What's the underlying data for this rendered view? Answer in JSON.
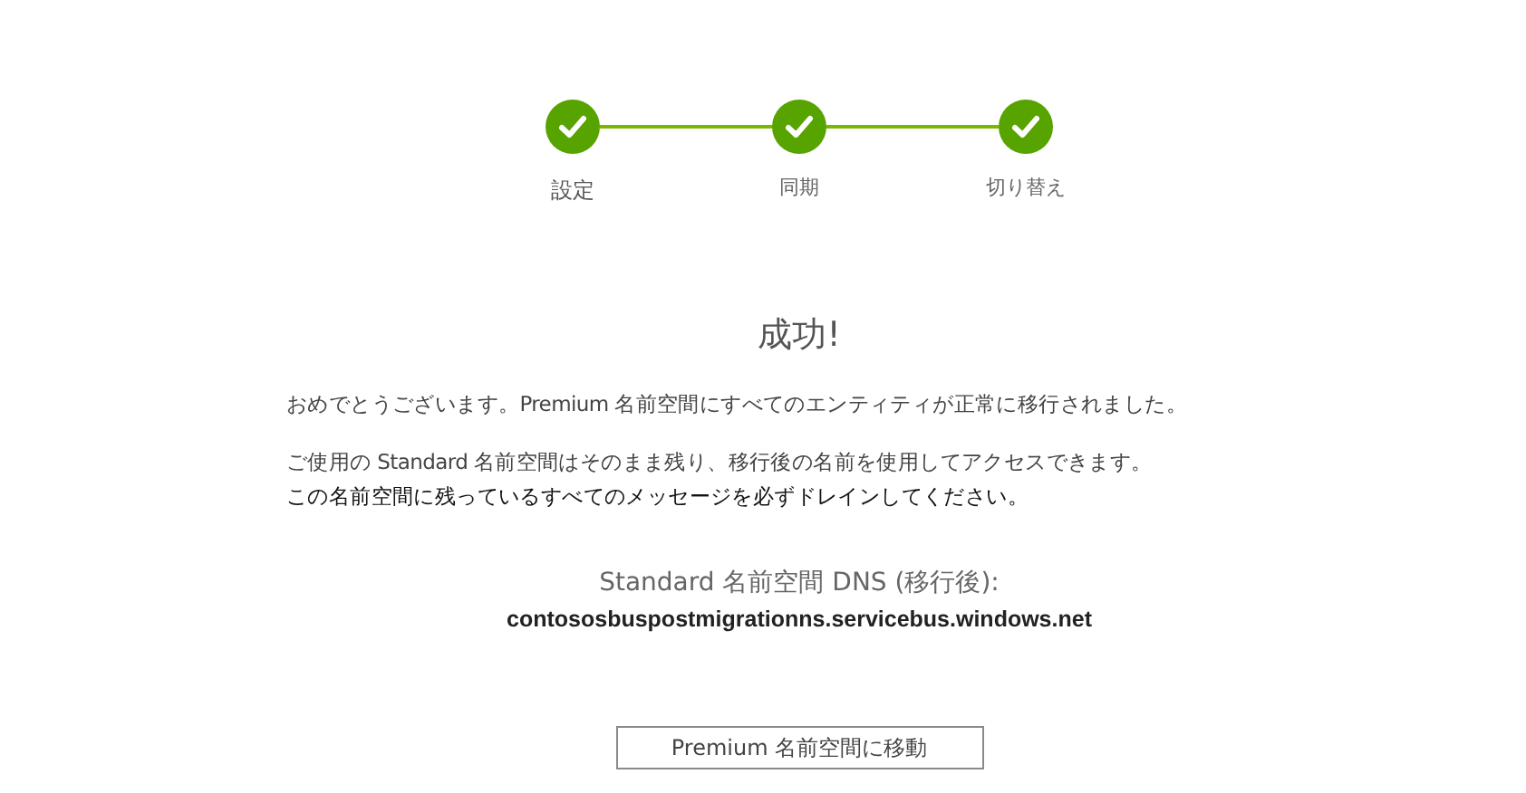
{
  "steps": [
    {
      "label": "設定",
      "completed": true
    },
    {
      "label": "同期",
      "completed": true
    },
    {
      "label": "切り替え",
      "completed": true
    }
  ],
  "title": "成功!",
  "messages": [
    "おめでとうございます。Premium 名前空間にすべてのエンティティが正常に移行されました。",
    "ご使用の Standard 名前空間はそのまま残り、移行後の名前を使用してアクセスできます。",
    "この名前空間に残っているすべてのメッセージを必ずドレインしてください。"
  ],
  "dns": {
    "label": "Standard 名前空間 DNS (移行後):",
    "value": "contososbuspostmigrationns.servicebus.windows.net"
  },
  "button": "Premium 名前空間に移動"
}
